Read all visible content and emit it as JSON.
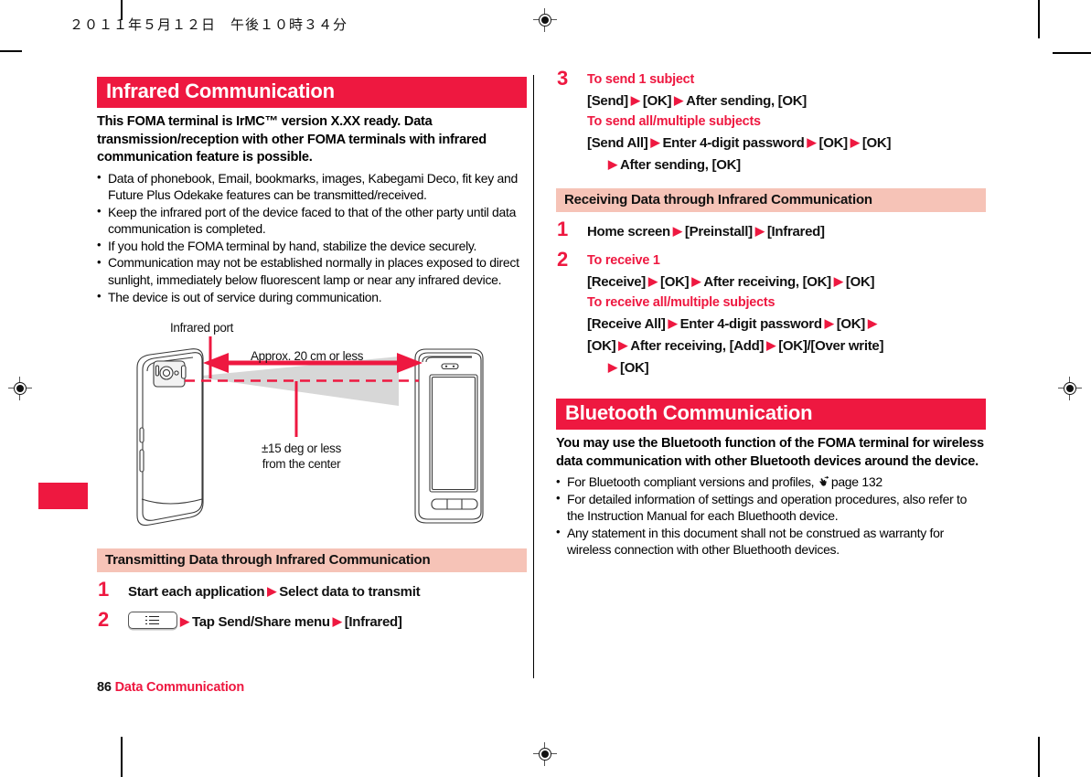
{
  "header": {
    "date_text": "２０１１年５月１２日　午後１０時３４分"
  },
  "footer": {
    "page_number": "86",
    "section_name": "Data Communication"
  },
  "colors": {
    "accent_red": "#ee1840",
    "sub_header_pink": "#f6c3b7",
    "text_black": "#111111"
  },
  "left_column": {
    "banner_title": "Infrared Communication",
    "lead_paragraph": "This FOMA terminal is IrMC™ version X.XX ready. Data transmission/reception with other FOMA terminals with infrared communication feature is possible.",
    "bullets": [
      "Data of phonebook, Email, bookmarks, images, Kabegami Deco, fit key and Future Plus Odekake features can be transmitted/received.",
      "Keep the infrared port of the device faced to that of the other party until data communication is completed.",
      "If you hold the FOMA terminal by hand, stabilize the device securely.",
      "Communication may not be established normally in places exposed to direct sunlight, immediately below fluorescent lamp or near any infrared device.",
      "The device is out of service during communication."
    ],
    "figure": {
      "label_infrared_port": "Infrared port",
      "label_distance": "Approx. 20 cm or less",
      "label_angle_line1": "±15 deg or less",
      "label_angle_line2": "from the center"
    },
    "sub_header": "Transmitting Data through Infrared Communication",
    "steps": [
      {
        "number": "1",
        "lines": [
          {
            "segments": [
              {
                "type": "text",
                "value": "Start each application"
              },
              {
                "type": "arrow"
              },
              {
                "type": "text",
                "value": "Select data to transmit"
              }
            ]
          }
        ]
      },
      {
        "number": "2",
        "lines": [
          {
            "segments": [
              {
                "type": "key-menu"
              },
              {
                "type": "arrow"
              },
              {
                "type": "text",
                "value": "Tap Send/Share menu"
              },
              {
                "type": "arrow"
              },
              {
                "type": "text",
                "value": "[Infrared]"
              }
            ]
          }
        ]
      }
    ]
  },
  "right_column": {
    "step3": {
      "number": "3",
      "label_a": "To send 1 subject",
      "line_a": "[Send] ▶ [OK] ▶ After sending, [OK]",
      "label_b": "To send all/multiple subjects",
      "line_b": "[Send All] ▶ Enter 4-digit password ▶ [OK] ▶ [OK]",
      "line_b_cont": "▶ After sending, [OK]"
    },
    "sub_header": "Receiving Data through Infrared Communication",
    "step1": {
      "number": "1",
      "line": "Home screen ▶ [Preinstall] ▶ [Infrared]"
    },
    "step2": {
      "number": "2",
      "label_a": "To receive 1",
      "line_a": "[Receive] ▶ [OK] ▶ After receiving, [OK] ▶ [OK]",
      "label_b": "To receive all/multiple subjects",
      "line_b": "[Receive All] ▶ Enter 4-digit password ▶ [OK] ▶",
      "line_b_cont": "[OK] ▶ After receiving, [Add] ▶ [OK]/[Over write]",
      "line_b_cont2": "▶ [OK]"
    },
    "banner_title": "Bluetooth Communication",
    "lead_paragraph": "You may use the Bluetooth function of the FOMA terminal for wireless data communication with other Bluetooth devices around the device.",
    "bullets": [
      "For Bluetooth compliant versions and profiles, ☞ page 132",
      "For detailed information of settings and operation procedures, also refer to the Instruction Manual for each Bluethooth device.",
      "Any statement in this document shall not be construed as warranty for wireless connection with other Bluethooth devices."
    ],
    "bullet1_prefix": "For Bluetooth compliant versions and profiles,",
    "bullet1_reference": "page 132"
  }
}
